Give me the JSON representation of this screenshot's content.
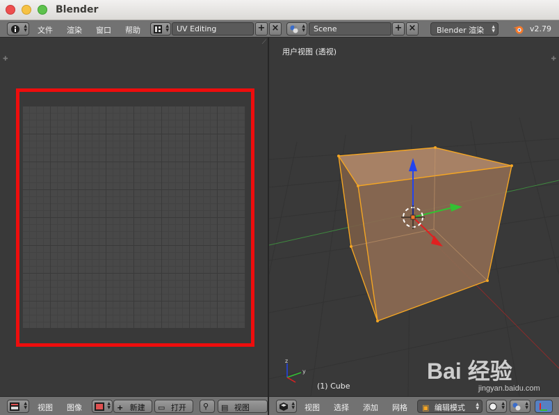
{
  "window": {
    "title": "Blender"
  },
  "info_header": {
    "menus": [
      "文件",
      "渲染",
      "窗口",
      "帮助"
    ],
    "screen_layout": "UV Editing",
    "scene": "Scene",
    "render_engine": "Blender 渲染",
    "version": "v2.79"
  },
  "image_editor": {
    "footer_menus": [
      "视图",
      "图像"
    ],
    "new_label": "新建",
    "open_label": "打开",
    "view_label": "视图"
  },
  "viewport": {
    "label": "用户视图 (透视)",
    "object_label": "(1) Cube",
    "footer_menus": [
      "视图",
      "选择",
      "添加",
      "网格"
    ],
    "mode": "编辑模式"
  },
  "watermark": {
    "text": "Bai 经验",
    "url": "jingyan.baidu.com"
  },
  "colors": {
    "highlight": "#ee0d0d",
    "selection": "#f5a623"
  }
}
